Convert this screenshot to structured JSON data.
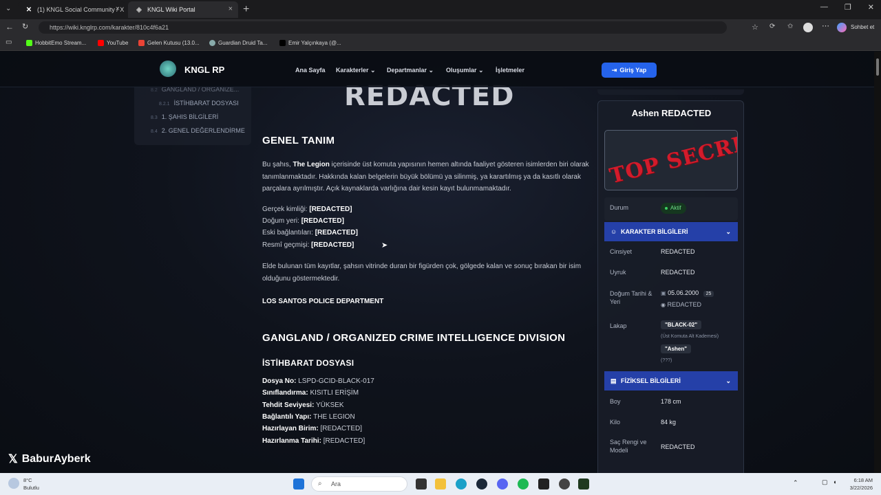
{
  "browser": {
    "tabs": [
      {
        "label": "(1) KNGL Social Community / X",
        "icon": "x-logo-icon"
      },
      {
        "label": "KNGL Wiki Portal",
        "icon": "site-icon"
      }
    ],
    "url": "https://wiki.knglrp.com/karakter/810c4f6a21",
    "profile_label": "Sohbet et",
    "bookmarks": [
      "HobbitEmo Stream...",
      "YouTube",
      "Gelen Kutusu (13.0...",
      "Guardian Druid Ta...",
      "Emir Yalçınkaya (@..."
    ]
  },
  "nav": {
    "brand": "KNGL RP",
    "links": [
      "Ana Sayfa",
      "Karakterler",
      "Departmanlar",
      "Oluşumlar",
      "İşletmeler"
    ],
    "login": "Giriş Yap"
  },
  "toc": {
    "items": [
      {
        "num": "8.2",
        "label": "GANGLAND / ORGANIZE..."
      },
      {
        "num": "8.2.1",
        "label": "İSTİHBARAT DOSYASI"
      },
      {
        "num": "8.3",
        "label": "1. ŞAHIS BİLGİLERİ"
      },
      {
        "num": "8.4",
        "label": "2. GENEL DEĞERLENDİRME"
      }
    ]
  },
  "main": {
    "hero": "REDACTED",
    "genel_heading": "GENEL TANIM",
    "intro_pre": "Bu şahıs, ",
    "intro_bold": "The Legion",
    "intro_post": " içerisinde üst komuta yapısının hemen altında faaliyet gösteren isimlerden biri olarak tanımlanmaktadır. Hakkında kalan belgelerin büyük bölümü ya silinmiş, ya karartılmış ya da kasıtlı olarak parçalara ayrılmıştır. Açık kaynaklarda varlığına dair kesin kayıt bulunmamaktadır.",
    "facts": [
      {
        "label": "Gerçek kimliği:",
        "value": "[REDACTED]"
      },
      {
        "label": "Doğum yeri:",
        "value": "[REDACTED]"
      },
      {
        "label": "Eski bağlantıları:",
        "value": "[REDACTED]"
      },
      {
        "label": "Resmî geçmişi:",
        "value": "[REDACTED]"
      }
    ],
    "closing": "Elde bulunan tüm kayıtlar, şahsın vitrinde duran bir figürden çok, gölgede kalan ve sonuç bırakan bir isim olduğunu göstermektedir.",
    "department": "LOS SANTOS POLICE DEPARTMENT",
    "division_heading": "GANGLAND / ORGANIZED CRIME INTELLIGENCE DIVISION",
    "dossier_heading": "İSTİHBARAT DOSYASI",
    "dossier": [
      {
        "label": "Dosya No:",
        "value": "LSPD-GCID-BLACK-017"
      },
      {
        "label": "Sınıflandırma:",
        "value": "KISITLI ERİŞİM"
      },
      {
        "label": "Tehdit Seviyesi:",
        "value": "YÜKSEK"
      },
      {
        "label": "Bağlantılı Yapı:",
        "value": "THE LEGION"
      },
      {
        "label": "Hazırlayan Birim:",
        "value": "[REDACTED]"
      },
      {
        "label": "Hazırlanma Tarihi:",
        "value": "[REDACTED]"
      }
    ]
  },
  "card": {
    "name": "Ashen REDACTED",
    "stamp": "TOP SECRET",
    "status_label": "Durum",
    "status_value": "Aktif",
    "section_char": "KARAKTER BİLGİLERİ",
    "cinsiyet_label": "Cinsiyet",
    "cinsiyet_value": "REDACTED",
    "uyruk_label": "Uyruk",
    "uyruk_value": "REDACTED",
    "dogum_label": "Doğum Tarihi & Yeri",
    "dogum_date": "05.06.2000",
    "dogum_age": "25",
    "dogum_place": "REDACTED",
    "lakap_label": "Lakap",
    "lakap1": "\"BLACK-02\"",
    "lakap1_note": "(Üst Komuta Alt Kademesi)",
    "lakap2": "\"Ashen\"",
    "lakap2_note": "(???)",
    "section_phys": "FİZİKSEL BİLGİLERİ",
    "boy_label": "Boy",
    "boy_value": "178 cm",
    "kilo_label": "Kilo",
    "kilo_value": "84 kg",
    "sac_label": "Saç Rengi ve Modeli",
    "sac_value": "REDACTED"
  },
  "watermark": "BaburAyberk",
  "taskbar": {
    "weather_temp": "8°C",
    "weather_desc": "Bulutlu",
    "search": "Ara",
    "time": "6:18 AM",
    "date": "3/22/2026"
  },
  "colors": {
    "accent": "#2563eb",
    "section": "#2540a8",
    "stamp": "#d31b2b",
    "status": "#3ecf63"
  }
}
